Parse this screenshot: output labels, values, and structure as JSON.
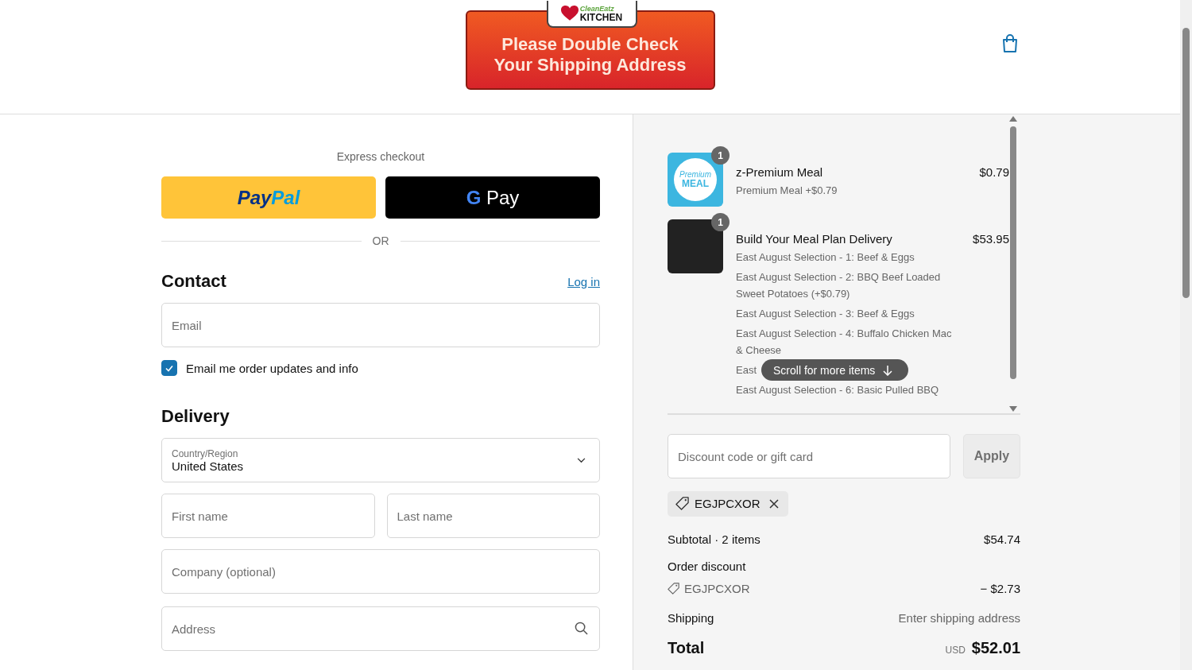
{
  "banner": {
    "logo_top": "CleanEatz",
    "logo_bottom": "KITCHEN",
    "lines": [
      "Please Double Check",
      "Your Shipping Address"
    ]
  },
  "express": {
    "label": "Express checkout",
    "buttons": [
      {
        "kind": "paypal",
        "label_a": "Pay",
        "label_b": "Pal"
      },
      {
        "kind": "gpay",
        "label_a": "G",
        "label_b": "Pay"
      }
    ],
    "divider": "OR"
  },
  "contact": {
    "title": "Contact",
    "login": "Log in",
    "email": {
      "placeholder": "Email"
    },
    "newsletter": {
      "label": "Email me order updates and info",
      "checked": true
    }
  },
  "delivery": {
    "title": "Delivery",
    "country": {
      "label": "Country/Region",
      "value": "United States"
    },
    "first_name": {
      "placeholder": "First name"
    },
    "last_name": {
      "placeholder": "Last name"
    },
    "company": {
      "placeholder": "Company (optional)"
    },
    "address": {
      "placeholder": "Address"
    }
  },
  "items": [
    {
      "kind": "premium",
      "quantity": "1",
      "name": "z-Premium Meal",
      "price": "$0.79",
      "thumb_top": "Premium",
      "thumb_bottom": "MEAL",
      "options": [
        "Premium Meal +$0.79"
      ]
    },
    {
      "kind": "photo",
      "quantity": "1",
      "name": "Build Your Meal Plan Delivery",
      "price": "$53.95",
      "options": [
        "East August Selection - 1: Beef & Eggs",
        "East August Selection - 2: BBQ Beef Loaded Sweet Potatoes (+$0.79)",
        "East August Selection - 3: Beef & Eggs",
        "East August Selection - 4: Buffalo Chicken Mac & Cheese",
        "East",
        "East August Selection - 6: Basic Pulled BBQ"
      ]
    }
  ],
  "scroll_hint": "Scroll for more items",
  "discount": {
    "placeholder": "Discount code or gift card",
    "apply": "Apply",
    "applied_code": "EGJPCXOR"
  },
  "totals": {
    "subtotal_label": "Subtotal · 2 items",
    "subtotal": "$54.74",
    "discount_label": "Order discount",
    "discount_code": "EGJPCXOR",
    "discount_amount": "− $2.73",
    "shipping_label": "Shipping",
    "shipping": "Enter shipping address",
    "total_label": "Total",
    "currency": "USD",
    "total": "$52.01"
  }
}
